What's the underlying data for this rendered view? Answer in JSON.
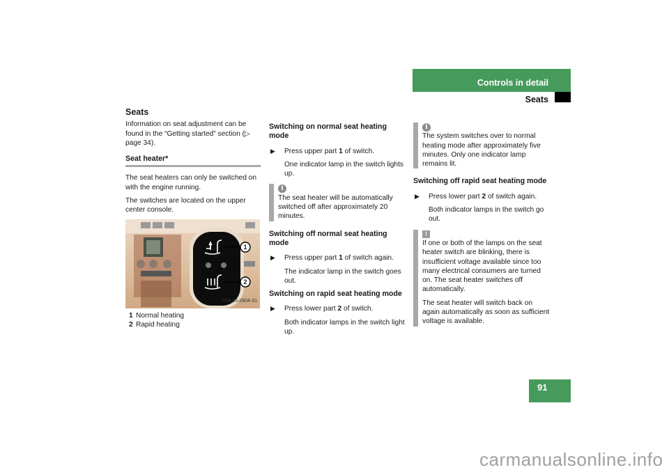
{
  "header": {
    "chapter": "Controls in detail",
    "section": "Seats",
    "page_number": "91",
    "accent_color": "#469b5c"
  },
  "col1": {
    "title": "Seats",
    "intro": "Information on seat adjustment can be found in the “Getting started” section (▷ page 34).",
    "subhead": "Seat heater*",
    "para1": "The seat heaters can only be switched on with the engine running.",
    "para2": "The switches are located on the upper center console.",
    "figure": {
      "code": "P54.25-2804-31",
      "callouts": [
        "1",
        "2"
      ]
    },
    "legend": [
      {
        "num": "1",
        "label": "Normal heating"
      },
      {
        "num": "2",
        "label": "Rapid heating"
      }
    ]
  },
  "col2": {
    "sec1": {
      "heading": "Switching on normal seat heating mode",
      "step_pre": "Press upper part ",
      "step_num": "1",
      "step_post": " of switch.",
      "result": "One indicator lamp in the switch lights up.",
      "note_icon": "info-icon",
      "note": "The seat heater will be automatically switched off after approximately 20 minutes."
    },
    "sec2": {
      "heading": "Switching off normal seat heating mode",
      "step_pre": "Press upper part ",
      "step_num": "1",
      "step_post": " of switch again.",
      "result": "The indicator lamp in the switch goes out."
    },
    "sec3": {
      "heading": "Switching on rapid seat heating mode",
      "step_pre": "Press lower part ",
      "step_num": "2",
      "step_post": " of switch.",
      "result": "Both indicator lamps in the switch light up."
    }
  },
  "col3": {
    "note1_icon": "info-icon",
    "note1": "The system switches over to normal heating mode after approximately five minutes. Only one indicator lamp remains lit.",
    "sec4": {
      "heading": "Switching off rapid seat heating mode",
      "step_pre": "Press lower part ",
      "step_num": "2",
      "step_post": " of switch again.",
      "result": "Both indicator lamps in the switch go out."
    },
    "warn_icon": "warning-icon",
    "warn1": "If one or both of the lamps on the seat heater switch are blinking, there is insufficient voltage available since too many electrical consumers are turned on. The seat heater switches off automatically.",
    "warn2": "The seat heater will switch back on again automatically as soon as sufficient voltage is available."
  },
  "watermark": "carmanualsonline.info"
}
